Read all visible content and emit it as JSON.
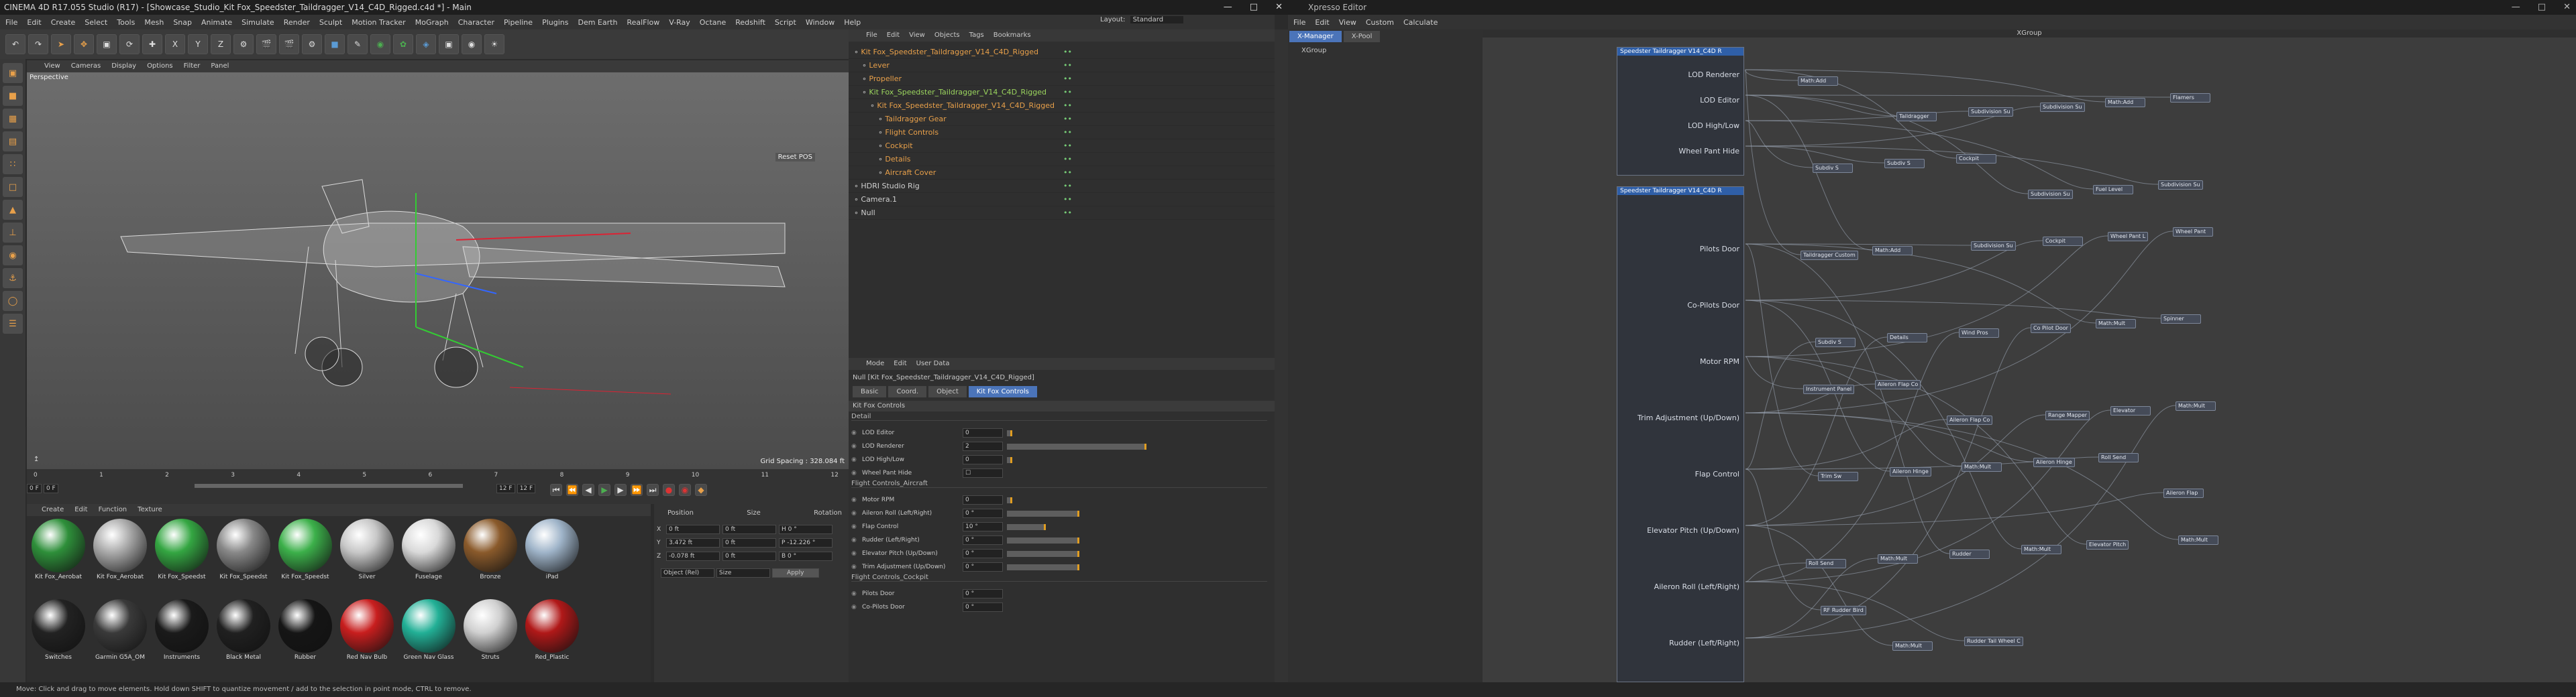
{
  "title": "CINEMA 4D R17.055 Studio (R17) - [Showcase_Studio_Kit Fox_Speedster_Taildragger_V14_C4D_Rigged.c4d *] - Main",
  "xpresso_title": "Xpresso Editor",
  "main_menu": [
    "File",
    "Edit",
    "Create",
    "Select",
    "Tools",
    "Mesh",
    "Snap",
    "Animate",
    "Simulate",
    "Render",
    "Sculpt",
    "Motion Tracker",
    "MoGraph",
    "Character",
    "Pipeline",
    "Plugins",
    "Dem Earth",
    "RealFlow",
    "V-Ray",
    "Octane",
    "Redshift",
    "Script",
    "Window",
    "Help"
  ],
  "layout_label": "Layout:",
  "layout_value": "Standard",
  "viewport": {
    "menu": [
      "View",
      "Cameras",
      "Display",
      "Options",
      "Filter",
      "Panel"
    ],
    "label": "Perspective",
    "reset_pose": "Reset POS",
    "grid_spacing": "Grid Spacing : 328.084 ft"
  },
  "timeline": {
    "ticks": [
      "0",
      "1",
      "2",
      "3",
      "4",
      "5",
      "6",
      "7",
      "8",
      "9",
      "10",
      "11",
      "12"
    ],
    "start": "0 F",
    "current": "0 F",
    "end": "12 F",
    "end2": "12 F",
    "frame_label": "0 F"
  },
  "material_menu": [
    "Create",
    "Edit",
    "Function",
    "Texture"
  ],
  "materials": [
    {
      "name": "Kit Fox_Aerobat",
      "color": "#2e8f3a"
    },
    {
      "name": "Kit Fox_Aerobat",
      "color": "#aaaaaa"
    },
    {
      "name": "Kit Fox_Speedst",
      "color": "#34a642"
    },
    {
      "name": "Kit Fox_Speedst",
      "color": "#888888"
    },
    {
      "name": "Kit Fox_Speedst",
      "color": "#3cb04a"
    },
    {
      "name": "Silver",
      "color": "#c7c7c7"
    },
    {
      "name": "Fuselage",
      "color": "#d9d9d9"
    },
    {
      "name": "Bronze",
      "color": "#8a5a2b"
    },
    {
      "name": "iPad",
      "color": "#9fb4c9"
    },
    {
      "name": "Switches",
      "color": "#222222"
    },
    {
      "name": "Garmin G5A_OM",
      "color": "#3a3a3a"
    },
    {
      "name": "Instruments",
      "color": "#1a1a1a"
    },
    {
      "name": "Black Metal",
      "color": "#202020"
    },
    {
      "name": "Rubber",
      "color": "#151515"
    },
    {
      "name": "Red Nav Bulb",
      "color": "#c81e1e"
    },
    {
      "name": "Green Nav Glass",
      "color": "#22b096"
    },
    {
      "name": "Struts",
      "color": "#d0d0d0"
    },
    {
      "name": "Red_Plastic",
      "color": "#b01818"
    }
  ],
  "coords": {
    "headers": [
      "Position",
      "Size",
      "Rotation"
    ],
    "rows": [
      {
        "axis": "X",
        "pos": "0 ft",
        "size": "0 ft",
        "rot": "H  0 °"
      },
      {
        "axis": "Y",
        "pos": "3.472 ft",
        "size": "0 ft",
        "rot": "P  -12.226 °"
      },
      {
        "axis": "Z",
        "pos": "-0.078 ft",
        "size": "0 ft",
        "rot": "B  0 °"
      }
    ],
    "mode1": "Object (Rel)",
    "mode2": "Size",
    "apply": "Apply"
  },
  "object_manager": {
    "menu": [
      "File",
      "Edit",
      "View",
      "Objects",
      "Tags",
      "Bookmarks"
    ],
    "objects": [
      {
        "name": "Kit Fox_Speedster_Taildragger_V14_C4D_Rigged",
        "indent": 0,
        "color": "#e8a04a"
      },
      {
        "name": "Lever",
        "indent": 1,
        "color": "#e8a04a"
      },
      {
        "name": "Propeller",
        "indent": 1,
        "color": "#e8a04a"
      },
      {
        "name": "Kit Fox_Speedster_Taildragger_V14_C4D_Rigged",
        "indent": 1,
        "color": "#9bd55e"
      },
      {
        "name": "Kit Fox_Speedster_Taildragger_V14_C4D_Rigged",
        "indent": 2,
        "color": "#e8a04a"
      },
      {
        "name": "Taildragger Gear",
        "indent": 3,
        "color": "#e8a04a"
      },
      {
        "name": "Flight Controls",
        "indent": 3,
        "color": "#e8a04a"
      },
      {
        "name": "Cockpit",
        "indent": 3,
        "color": "#e8a04a"
      },
      {
        "name": "Details",
        "indent": 3,
        "color": "#e8a04a"
      },
      {
        "name": "Aircraft Cover",
        "indent": 3,
        "color": "#e8a04a"
      },
      {
        "name": "HDRI Studio Rig",
        "indent": 0,
        "color": "#d0d0d0"
      },
      {
        "name": "Camera.1",
        "indent": 0,
        "color": "#d0d0d0"
      },
      {
        "name": "Null",
        "indent": 0,
        "color": "#d0d0d0"
      }
    ]
  },
  "attributes": {
    "menu": [
      "Mode",
      "Edit",
      "User Data"
    ],
    "object_title": "Null [Kit Fox_Speedster_Taildragger_V14_C4D_Rigged]",
    "tabs": [
      "Basic",
      "Coord.",
      "Object",
      "Kit Fox Controls"
    ],
    "active_tab": "Kit Fox Controls",
    "section": "Kit Fox Controls",
    "groups": [
      {
        "name": "Detail",
        "params": [
          {
            "label": "LOD Editor",
            "value": "0",
            "level": 0.0,
            "slider": true
          },
          {
            "label": "LOD Renderer",
            "value": "2",
            "level": 1.0,
            "slider": true
          },
          {
            "label": "LOD High/Low",
            "value": "0",
            "level": 0.0,
            "slider": true
          },
          {
            "label": "Wheel Pant Hide",
            "value": "☐",
            "level": 0.0,
            "slider": false
          }
        ]
      },
      {
        "name": "Flight Controls_Aircraft",
        "params": [
          {
            "label": "Motor RPM",
            "value": "0",
            "level": 0.0,
            "slider": true
          },
          {
            "label": "Aileron Roll (Left/Right)",
            "value": "0 °",
            "level": 0.5,
            "slider": true
          },
          {
            "label": "Flap Control",
            "value": "10 °",
            "level": 0.25,
            "slider": true
          },
          {
            "label": "Rudder (Left/Right)",
            "value": "0 °",
            "level": 0.5,
            "slider": true
          },
          {
            "label": "Elevator Pitch (Up/Down)",
            "value": "0 °",
            "level": 0.5,
            "slider": true
          },
          {
            "label": "Trim Adjustment (Up/Down)",
            "value": "0 °",
            "level": 0.5,
            "slider": true
          }
        ]
      },
      {
        "name": "Flight Controls_Cockpit",
        "params": [
          {
            "label": "Pilots Door",
            "value": "0 °",
            "level": 0.0,
            "slider": false
          },
          {
            "label": "Co-Pilots Door",
            "value": "0 °",
            "level": 0.0,
            "slider": false
          }
        ]
      }
    ]
  },
  "xpresso": {
    "menu": [
      "File",
      "Edit",
      "View",
      "Custom",
      "Calculate"
    ],
    "tabs": [
      "X-Manager",
      "X-Pool"
    ],
    "group_label": "XGroup",
    "canvas_title": "XGroup",
    "node1_title": "Speedster Taildragger V14_C4D R",
    "node1_ports": [
      "LOD Renderer",
      "LOD Editor",
      "LOD High/Low",
      "Wheel Pant Hide"
    ],
    "node2_title": "Speedster Taildragger V14_C4D R",
    "node2_ports": [
      "Pilots Door",
      "Co-Pilots Door",
      "Motor RPM",
      "Trim Adjustment (Up/Down)",
      "Flap Control",
      "Elevator Pitch (Up/Down)",
      "Aileron Roll (Left/Right)",
      "Rudder (Left/Right)"
    ],
    "small_nodes": [
      "Math:Add",
      "Taildragger",
      "Subdivision Su",
      "Subdivision Su",
      "Math:Add",
      "Flamers",
      "Subdiv S",
      "Subdiv S",
      "Cockpit",
      "Subdivision Su",
      "Fuel Level",
      "Subdivision Su",
      "Taildragger Custom",
      "Math:Add",
      "Subdivision Su",
      "Cockpit",
      "Wheel Pant L",
      "Wheel Pant",
      "Subdiv S",
      "Details",
      "Wind Pros",
      "Co Pilot Door",
      "Math:Mult",
      "Spinner",
      "Instrument Panel",
      "Aileron Flap Co",
      "Aileron Flap Co",
      "Range Mapper",
      "Elevator",
      "Math:Mult",
      "Trim Sw",
      "Aileron Hinge",
      "Math:Mult",
      "Aileron Hinge",
      "Roll Send",
      "Aileron Flap",
      "Roll Send",
      "Math:Mult",
      "Rudder",
      "Math:Mult",
      "Elevator Pitch",
      "Math:Mult",
      "RF Rudder Bird",
      "Math:Mult",
      "Rudder Tail Wheel C"
    ]
  },
  "status": "Move: Click and drag to move elements. Hold down SHIFT to quantize movement / add to the selection in point mode, CTRL to remove."
}
